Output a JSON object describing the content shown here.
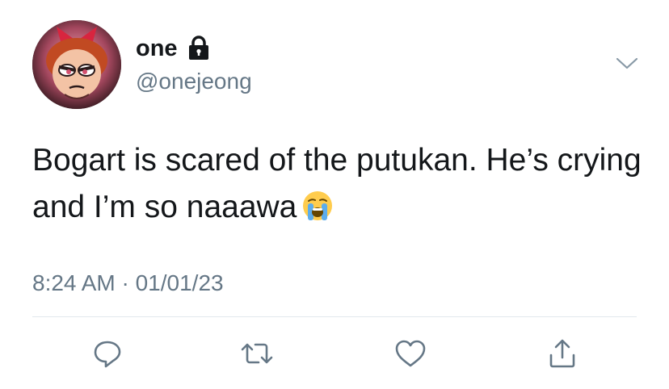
{
  "user": {
    "display_name": "one",
    "handle": "@onejeong",
    "avatar_icon": "powerpuff-blossom-avatar",
    "protected_icon": "lock-icon"
  },
  "tweet": {
    "text": "Bogart is scared of the putukan. He’s crying and I’m so naaawa",
    "emoji": "loudly-crying-face-emoji",
    "timestamp": "8:24 AM · 01/01/23"
  },
  "actions": [
    {
      "name": "reply",
      "icon": "reply-icon"
    },
    {
      "name": "retweet",
      "icon": "retweet-icon"
    },
    {
      "name": "like",
      "icon": "heart-icon"
    },
    {
      "name": "share",
      "icon": "share-icon"
    }
  ],
  "colors": {
    "text_primary": "#14171a",
    "text_secondary": "#657786",
    "icon": "#657786",
    "divider": "#e1e8ed"
  }
}
